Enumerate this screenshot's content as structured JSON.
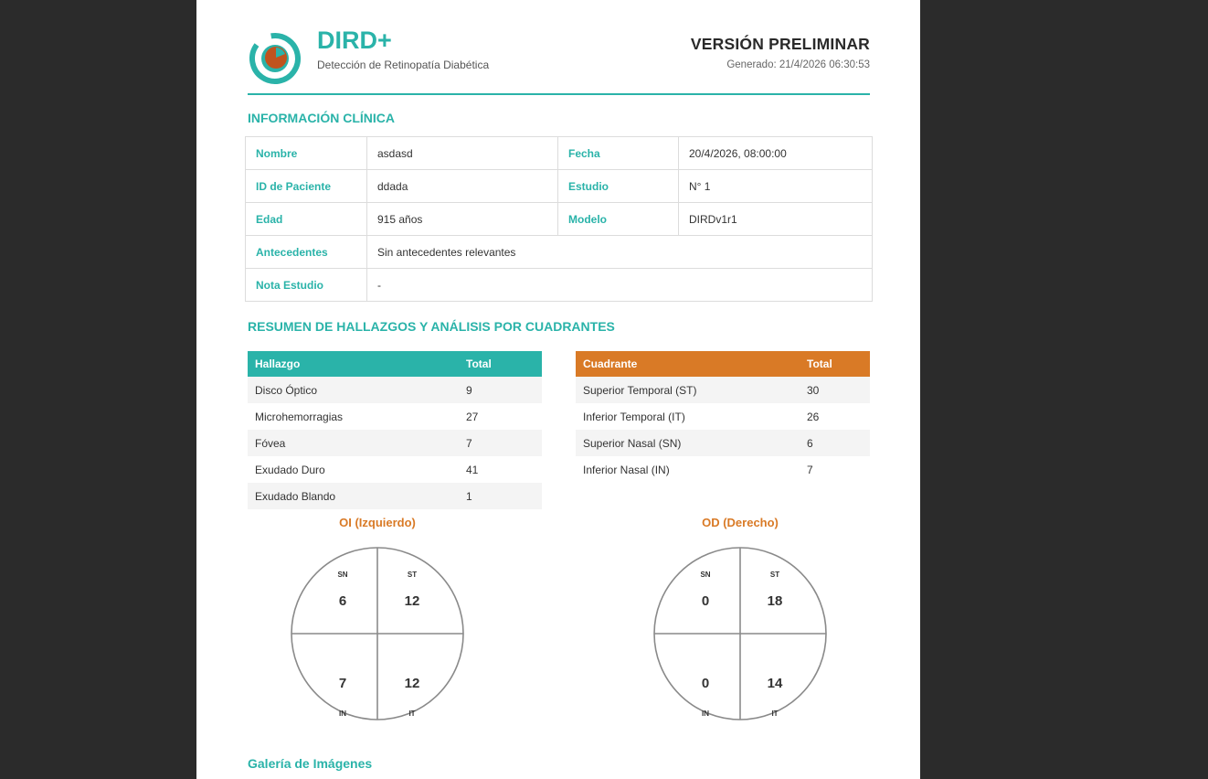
{
  "header": {
    "brand": "DIRD+",
    "subtitle": "Detección de Retinopatía Diabética",
    "version": "VERSIÓN PRELIMINAR",
    "generated": "Generado: 21/4/2026 06:30:53",
    "accent": "#2ab3a9",
    "logo_core_color": "#c0531e"
  },
  "clinical": {
    "title": "INFORMACIÓN CLÍNICA",
    "nombre_label": "Nombre",
    "nombre": "asdasd",
    "fecha_label": "Fecha",
    "fecha": "20/4/2026, 08:00:00",
    "id_label": "ID de Paciente",
    "id": "ddada",
    "estudio_label": "Estudio",
    "estudio": "N° 1",
    "edad_label": "Edad",
    "edad": "915 años",
    "modelo_label": "Modelo",
    "modelo": "DIRDv1r1",
    "antecedentes_label": "Antecedentes",
    "antecedentes": "Sin antecedentes relevantes",
    "nota_label": "Nota Estudio",
    "nota": "-"
  },
  "summary": {
    "title": "RESUMEN DE HALLAZGOS Y ANÁLISIS POR CUADRANTES",
    "findings_header": [
      "Hallazgo",
      "Total"
    ],
    "findings": [
      {
        "name": "Disco Óptico",
        "total": "9"
      },
      {
        "name": "Microhemorragias",
        "total": "27"
      },
      {
        "name": "Fóvea",
        "total": "7"
      },
      {
        "name": "Exudado Duro",
        "total": "41"
      },
      {
        "name": "Exudado Blando",
        "total": "1"
      }
    ],
    "quadrant_header": [
      "Cuadrante",
      "Total"
    ],
    "quadrants": [
      {
        "name": "Superior Temporal (ST)",
        "total": "30"
      },
      {
        "name": "Inferior Temporal (IT)",
        "total": "26"
      },
      {
        "name": "Superior Nasal (SN)",
        "total": "6"
      },
      {
        "name": "Inferior Nasal (IN)",
        "total": "7"
      }
    ],
    "header_colors": {
      "findings": "#2ab3a9",
      "quadrants": "#d97a26"
    }
  },
  "eyes": {
    "left": {
      "title": "OI (Izquierdo)",
      "sn_label": "SN",
      "st_label": "ST",
      "in_label": "IN",
      "it_label": "IT",
      "sn": "6",
      "st": "12",
      "in": "7",
      "it": "12"
    },
    "right": {
      "title": "OD (Derecho)",
      "sn_label": "SN",
      "st_label": "ST",
      "in_label": "IN",
      "it_label": "IT",
      "sn": "0",
      "st": "18",
      "in": "0",
      "it": "14"
    }
  },
  "gallery": {
    "title": "Galería de Imágenes"
  }
}
